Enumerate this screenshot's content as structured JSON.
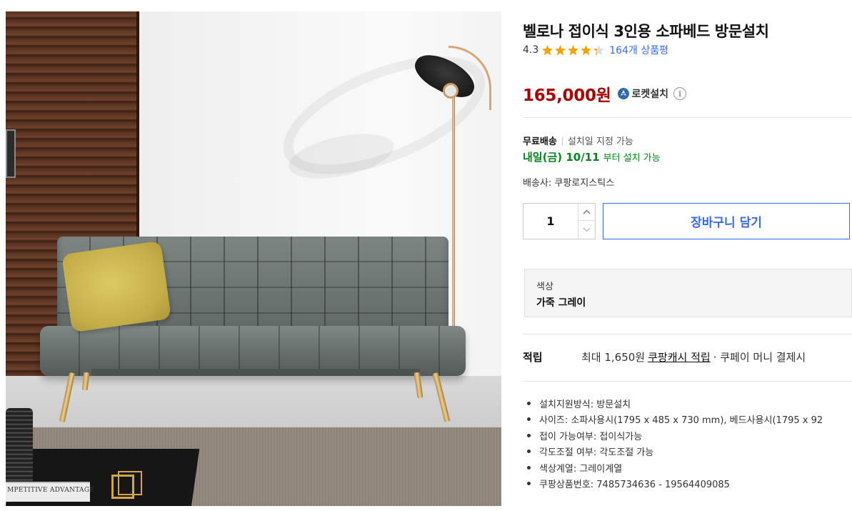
{
  "product": {
    "title": "벨로나 접이식 3인용 소파베드 방문설치",
    "rating": "4.3",
    "rating_value": 4.3,
    "rating_max": 5,
    "review_count": "164개 상품평",
    "price": "165,000원",
    "install_badge": "로켓설치"
  },
  "shipping": {
    "free": "무료배송",
    "schedule": "설치일 지정 가능",
    "arrival_date": "내일(금) 10/11",
    "arrival_suffix": "부터 설치 가능",
    "carrier": "배송사: 쿠팡로지스틱스"
  },
  "purchase": {
    "quantity": "1",
    "cart_button": "장바구니 담기"
  },
  "option": {
    "label": "색상",
    "value": "가죽 그레이"
  },
  "reward": {
    "title": "적립",
    "prefix": "최대 1,650원",
    "link": "쿠팡캐시 적립",
    "suffix": "· 쿠페이 머니 결제시"
  },
  "specs": [
    "설치지원방식: 방문설치",
    "사이즈: 소파사용시(1795 x 485 x 730 mm), 베드사용시(1795 x 92",
    "접이 가능여부: 접이식가능",
    "각도조절 여부: 각도조절 가능",
    "색상계열: 그레이계열",
    "쿠팡상품번호: 7485734636 - 19564409085"
  ],
  "photo": {
    "book_title": "MPETITIVE ADVANTAGE"
  },
  "colors": {
    "price": "#ae0000",
    "link_blue": "#346aff",
    "arrival_green": "#00891a",
    "star": "#f5a300"
  },
  "icons": {
    "star": "star-icon",
    "rocket": "rocket-install-icon",
    "info": "info-icon",
    "qty_up": "chevron-up-icon",
    "qty_down": "chevron-down-icon"
  }
}
